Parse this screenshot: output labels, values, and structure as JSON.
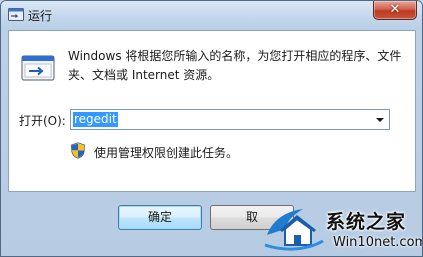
{
  "window": {
    "title": "运行",
    "close_glyph": "✕"
  },
  "dialog": {
    "description": "Windows 将根据您所输入的名称，为您打开相应的程序、文件夹、文档或 Internet 资源。",
    "open_label": "打开(O):",
    "input_value": "regedit",
    "admin_note": "使用管理权限创建此任务。"
  },
  "buttons": {
    "ok_label": "确定",
    "cancel_label": "取"
  },
  "watermark": {
    "title": "系统之家",
    "url": "Win10net.com"
  },
  "icons": {
    "title": "run-icon",
    "main": "run-window-icon",
    "uac": "uac-shield-icon",
    "dropdown": "chevron-down-icon",
    "watermark": "house-logo-icon"
  },
  "colors": {
    "selection": "#3399ff",
    "close_button": "#c8553d",
    "frame": "#b9cfe6"
  }
}
